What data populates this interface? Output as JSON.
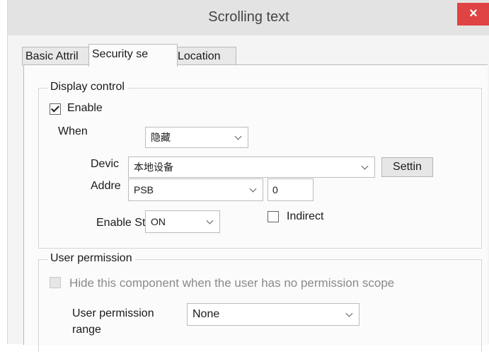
{
  "window": {
    "title": "Scrolling text",
    "close_glyph": "×"
  },
  "tabs": [
    {
      "label": "Basic Attril"
    },
    {
      "label": "Security se"
    },
    {
      "label": "Location"
    }
  ],
  "display_control": {
    "legend": "Display control",
    "enable": {
      "label": "Enable",
      "checked": true
    },
    "when": {
      "label": "When",
      "value": "隐藏"
    },
    "device": {
      "label": "Devic",
      "value": "本地设备",
      "settings_label": "Settin"
    },
    "address": {
      "label": "Addre",
      "type_value": "PSB",
      "number_value": "0"
    },
    "enable_state": {
      "label": "Enable Sta",
      "value": "ON"
    },
    "indirect": {
      "label": "Indirect",
      "checked": false
    }
  },
  "user_permission": {
    "legend": "User permission",
    "hide": {
      "label": "Hide this component when the user has no permission scope",
      "checked": false,
      "disabled": true
    },
    "range": {
      "label_line1": "User permission",
      "label_line2": "range",
      "value": "None"
    }
  }
}
